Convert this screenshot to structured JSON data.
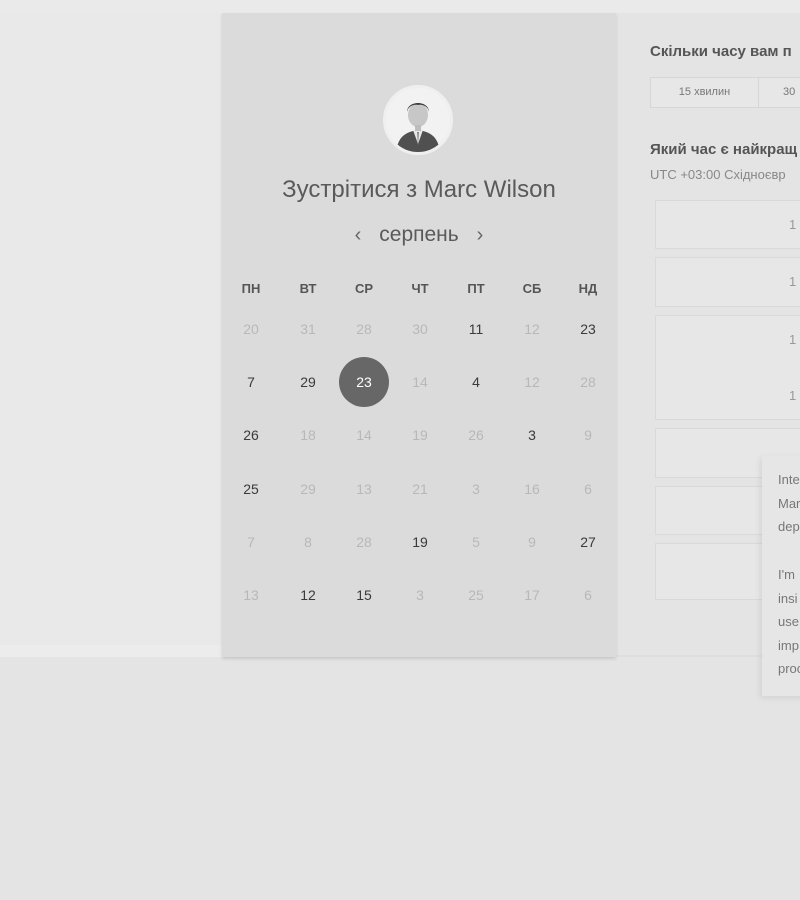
{
  "host": {
    "title": "Зустрітися з Marc Wilson",
    "avatar_icon": "avatar-photo"
  },
  "calendar": {
    "month": "серпень",
    "prev_icon": "chevron-left-icon",
    "next_icon": "chevron-right-icon",
    "weekdays": [
      "ПН",
      "ВТ",
      "СР",
      "ЧТ",
      "ПТ",
      "СБ",
      "НД"
    ],
    "weeks": [
      [
        "20",
        "31",
        "28",
        "30",
        "11",
        "12",
        "23"
      ],
      [
        "7",
        "29",
        "23",
        "14",
        "4",
        "12",
        "28"
      ],
      [
        "26",
        "18",
        "14",
        "19",
        "26",
        "3",
        "9"
      ],
      [
        "25",
        "29",
        "13",
        "21",
        "3",
        "16",
        "6"
      ],
      [
        "7",
        "8",
        "28",
        "19",
        "5",
        "9",
        "27"
      ],
      [
        "13",
        "12",
        "15",
        "3",
        "25",
        "17",
        "6"
      ]
    ],
    "available": [
      [
        false,
        false,
        false,
        false,
        true,
        false,
        true
      ],
      [
        true,
        true,
        true,
        false,
        true,
        false,
        false
      ],
      [
        true,
        false,
        false,
        false,
        false,
        true,
        false
      ],
      [
        true,
        false,
        false,
        false,
        false,
        false,
        false
      ],
      [
        false,
        false,
        false,
        true,
        false,
        false,
        true
      ],
      [
        false,
        true,
        true,
        false,
        false,
        false,
        false
      ]
    ],
    "selected": [
      1,
      2
    ]
  },
  "duration": {
    "question": "Скільки часу вам п",
    "options": [
      "15 хвилин",
      "30"
    ]
  },
  "time": {
    "question": "Який час є найкращ",
    "timezone": "UTC +03:00 Східноєвр",
    "slots": [
      "1",
      "1",
      "1",
      "1",
      "",
      "",
      ""
    ]
  },
  "popup": {
    "lines": [
      "Inte",
      "Mar",
      "dep",
      "",
      "I'm",
      "insi",
      "use",
      "imp",
      "proc"
    ]
  }
}
